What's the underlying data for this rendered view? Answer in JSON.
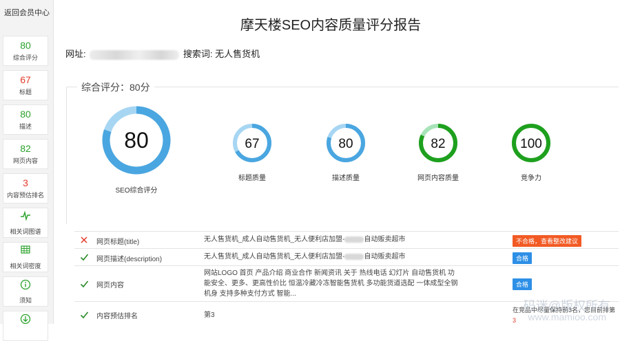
{
  "sidebar": {
    "back_label": "返回会员中心",
    "items": [
      {
        "value": "80",
        "label": "综合评分",
        "color": "#2aa12a"
      },
      {
        "value": "67",
        "label": "标题",
        "color": "#e23a2a"
      },
      {
        "value": "80",
        "label": "描述",
        "color": "#2aa12a"
      },
      {
        "value": "82",
        "label": "网页内容",
        "color": "#2aa12a"
      },
      {
        "value": "3",
        "label": "内容预估排名",
        "color": "#e23a2a"
      },
      {
        "icon": "pulse-icon",
        "label": "相关词图谱"
      },
      {
        "icon": "grid-icon",
        "label": "相关词密度"
      },
      {
        "icon": "info-icon",
        "label": "须知"
      },
      {
        "icon": "download-icon",
        "label": ""
      }
    ]
  },
  "report": {
    "title": "摩天楼SEO内容质量评分报告",
    "url_label": "网址:",
    "keyword_label": "搜索词:",
    "keyword": "无人售货机"
  },
  "overall": {
    "legend": "综合评分：80分",
    "gauges": [
      {
        "value": 80,
        "label": "SEO综合评分",
        "color": "#4aa6e0",
        "light": "#a7d6f3"
      },
      {
        "value": 67,
        "label": "标题质量",
        "color": "#4aa6e0",
        "light": "#a7d6f3"
      },
      {
        "value": 80,
        "label": "描述质量",
        "color": "#4aa6e0",
        "light": "#a7d6f3"
      },
      {
        "value": 82,
        "label": "网页内容质量",
        "color": "#1ea01e",
        "light": "#a9e3b9"
      },
      {
        "value": 100,
        "label": "竞争力",
        "color": "#1ea01e",
        "light": "#a9e3b9"
      }
    ]
  },
  "results": [
    {
      "status": "fail",
      "name": "网页标题(title)",
      "value_a": "无人售货机_成人自动售货机_无人便利店加盟-",
      "value_b": "自动贩卖超市",
      "tag": "不合格，查看整改建议",
      "tag_color": "#f25a24"
    },
    {
      "status": "pass",
      "name": "网页描述(description)",
      "value_a": "无人售货机_成人自动售货机_无人便利店加盟-",
      "value_b": "自动贩卖超市",
      "tag": "合格",
      "tag_color": "#2d8fe6"
    },
    {
      "status": "pass",
      "name": "网页内容",
      "value": "网站LOGO 首页 产品介绍 商业合作 新闻资讯 关于 热线电话 幻灯片 自动售货机 功能安全、更多、更高性价比 恒温冷藏冷冻智能售货机 多功能货道选配 一体成型全钢机身 支持多种支付方式 智能...",
      "tag": "合格",
      "tag_color": "#2d8fe6"
    },
    {
      "status": "pass",
      "name": "内容预估排名",
      "value": "第3",
      "note": "在竞品中尽量保持前3名，您目前排第",
      "note_num": "3"
    }
  ],
  "watermark": {
    "line1": "码迷@版权所有",
    "line2": "www.mamioo.com"
  }
}
